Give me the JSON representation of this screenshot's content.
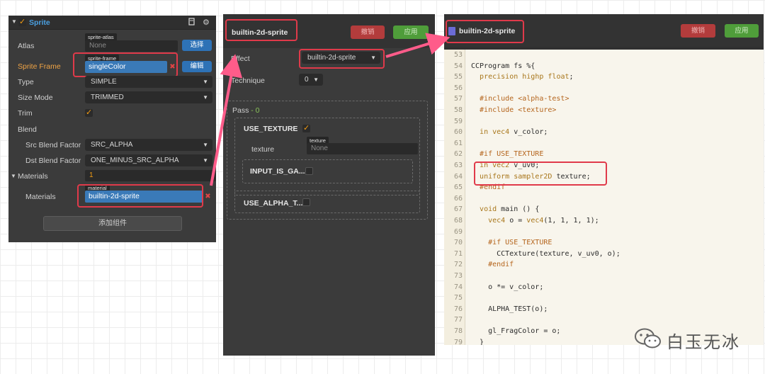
{
  "sprite_panel": {
    "component_title": "Sprite",
    "header_icons": [
      "book-icon",
      "gear-icon"
    ],
    "atlas": {
      "label": "Atlas",
      "tag": "sprite-atlas",
      "value": "None",
      "button": "选择"
    },
    "sprite_frame": {
      "label": "Sprite Frame",
      "tag": "sprite-frame",
      "value": "singleColor",
      "button": "编辑"
    },
    "type": {
      "label": "Type",
      "value": "SIMPLE"
    },
    "size_mode": {
      "label": "Size Mode",
      "value": "TRIMMED"
    },
    "trim": {
      "label": "Trim",
      "checked": true
    },
    "blend": {
      "label": "Blend"
    },
    "src_blend": {
      "label": "Src Blend Factor",
      "value": "SRC_ALPHA"
    },
    "dst_blend": {
      "label": "Dst Blend Factor",
      "value": "ONE_MINUS_SRC_ALPHA"
    },
    "materials_count": {
      "label": "Materials",
      "value": "1"
    },
    "materials_item": {
      "label": "Materials",
      "tag": "material",
      "value": "builtin-2d-sprite"
    },
    "add_component": "添加组件"
  },
  "material_panel": {
    "title": "builtin-2d-sprite",
    "revert": "撤销",
    "apply": "应用",
    "effect": {
      "label": "Effect",
      "value": "builtin-2d-sprite"
    },
    "technique": {
      "label": "Technique",
      "value": "0"
    },
    "pass": {
      "label": "Pass",
      "index": "- 0"
    },
    "use_texture": {
      "label": "USE_TEXTURE",
      "checked": true
    },
    "texture": {
      "label": "texture",
      "tag": "texture",
      "value": "None"
    },
    "input_is_gamma": {
      "label": "INPUT_IS_GA...",
      "checked": false
    },
    "use_alpha_test": {
      "label": "USE_ALPHA_T...",
      "checked": false
    }
  },
  "effect_panel": {
    "title": "builtin-2d-sprite",
    "revert": "撤销",
    "apply": "应用",
    "code_lines": [
      {
        "n": "53",
        "t": ""
      },
      {
        "n": "54",
        "t": "CCProgram fs %{"
      },
      {
        "n": "55",
        "t": "  precision highp float;"
      },
      {
        "n": "56",
        "t": ""
      },
      {
        "n": "57",
        "t": "  #include <alpha-test>"
      },
      {
        "n": "58",
        "t": "  #include <texture>"
      },
      {
        "n": "59",
        "t": ""
      },
      {
        "n": "60",
        "t": "  in vec4 v_color;"
      },
      {
        "n": "61",
        "t": ""
      },
      {
        "n": "62",
        "t": "  #if USE_TEXTURE"
      },
      {
        "n": "63",
        "t": "  in vec2 v_uv0;"
      },
      {
        "n": "64",
        "t": "  uniform sampler2D texture;"
      },
      {
        "n": "65",
        "t": "  #endif"
      },
      {
        "n": "66",
        "t": ""
      },
      {
        "n": "67",
        "t": "  void main () {"
      },
      {
        "n": "68",
        "t": "    vec4 o = vec4(1, 1, 1, 1);"
      },
      {
        "n": "69",
        "t": ""
      },
      {
        "n": "70",
        "t": "    #if USE_TEXTURE"
      },
      {
        "n": "71",
        "t": "      CCTexture(texture, v_uv0, o);"
      },
      {
        "n": "72",
        "t": "    #endif"
      },
      {
        "n": "73",
        "t": ""
      },
      {
        "n": "74",
        "t": "    o *= v_color;"
      },
      {
        "n": "75",
        "t": ""
      },
      {
        "n": "76",
        "t": "    ALPHA_TEST(o);"
      },
      {
        "n": "77",
        "t": ""
      },
      {
        "n": "78",
        "t": "    gl_FragColor = o;"
      },
      {
        "n": "79",
        "t": "  }"
      }
    ]
  },
  "watermark": {
    "text": "白玉无冰",
    "icon": "wechat-icon"
  },
  "colors": {
    "highlight": "#e03a4a",
    "arrow": "#ff5c8a",
    "accent": "#f39c12",
    "selection": "#3a7ab8"
  }
}
